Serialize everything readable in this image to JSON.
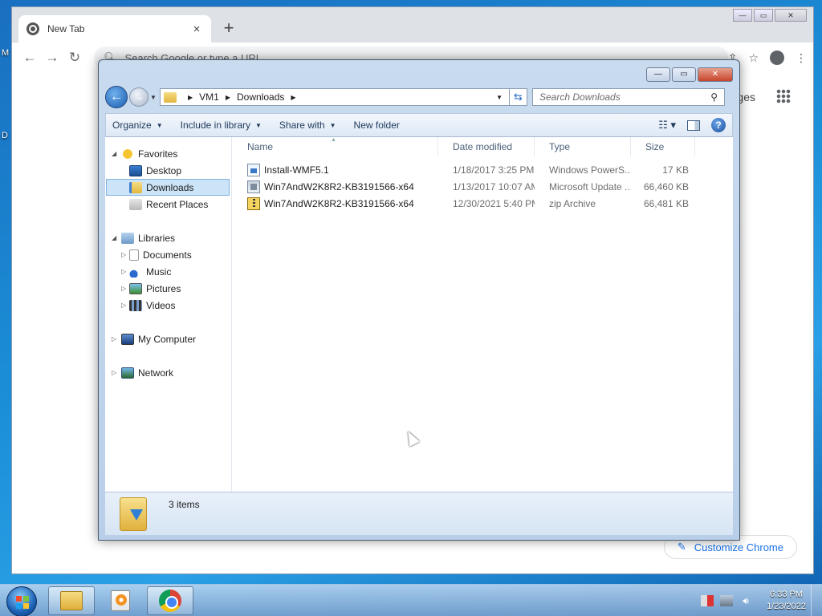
{
  "desktop": {
    "fragments": [
      "M",
      "D"
    ]
  },
  "chrome": {
    "tab_title": "New Tab",
    "tab_close": "×",
    "new_tab": "+",
    "omnibox_placeholder": "Search Google or type a URL",
    "apps_label": "ges",
    "customize_label": "Customize Chrome",
    "window_buttons": {
      "min": "—",
      "max": "▭",
      "close": "✕"
    }
  },
  "explorer": {
    "breadcrumb": [
      "VM1",
      "Downloads"
    ],
    "search_placeholder": "Search Downloads",
    "caption": {
      "min": "—",
      "max": "▭",
      "close": "✕"
    },
    "commands": {
      "organize": "Organize",
      "include_in_library": "Include in library",
      "share_with": "Share with",
      "new_folder": "New folder"
    },
    "nav": {
      "favorites": "Favorites",
      "desktop": "Desktop",
      "downloads": "Downloads",
      "recent_places": "Recent Places",
      "libraries": "Libraries",
      "documents": "Documents",
      "music": "Music",
      "pictures": "Pictures",
      "videos": "Videos",
      "my_computer": "My Computer",
      "network": "Network"
    },
    "columns": {
      "name": "Name",
      "date_modified": "Date modified",
      "type": "Type",
      "size": "Size"
    },
    "files": [
      {
        "name": "Install-WMF5.1",
        "date": "1/18/2017 3:25 PM",
        "type": "Windows PowerS...",
        "size": "17 KB",
        "icon": "powershell-script-icon"
      },
      {
        "name": "Win7AndW2K8R2-KB3191566-x64",
        "date": "1/13/2017 10:07 AM",
        "type": "Microsoft Update ...",
        "size": "66,460 KB",
        "icon": "update-package-icon"
      },
      {
        "name": "Win7AndW2K8R2-KB3191566-x64",
        "date": "12/30/2021 5:40 PM",
        "type": "zip Archive",
        "size": "66,481 KB",
        "icon": "zip-archive-icon"
      }
    ],
    "status": {
      "item_count": "3 items"
    }
  },
  "taskbar": {
    "clock_time": "6:33 PM",
    "clock_date": "1/23/2022"
  }
}
